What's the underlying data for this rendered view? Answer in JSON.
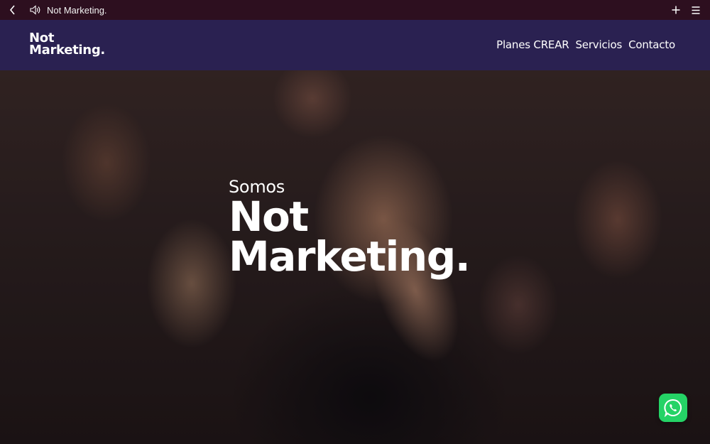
{
  "browser": {
    "tab_title": "Not Marketing.",
    "icons": {
      "back": "chevron-left-icon",
      "audio": "speaker-icon",
      "new_tab": "plus-icon",
      "menu": "hamburger-menu-icon"
    }
  },
  "header": {
    "logo_line1": "Not",
    "logo_line2": "Marketing.",
    "nav": [
      {
        "label": "Planes CREAR"
      },
      {
        "label": "Servicios"
      },
      {
        "label": "Contacto"
      }
    ],
    "bg_color": "#2a2151"
  },
  "hero": {
    "eyebrow": "Somos",
    "headline_line1": "Not",
    "headline_line2": "Marketing."
  },
  "whatsapp": {
    "icon": "whatsapp-icon",
    "color": "#25d366"
  }
}
